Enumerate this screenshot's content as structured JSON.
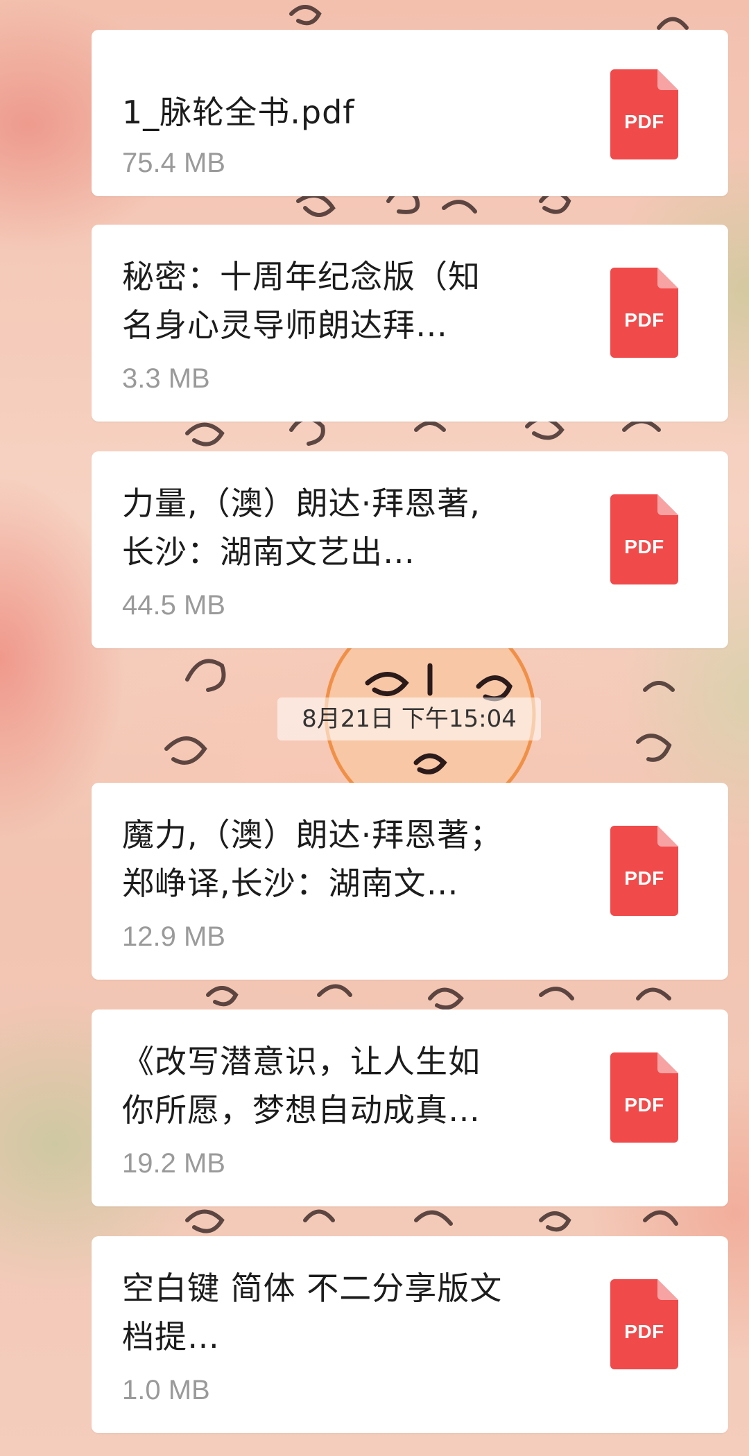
{
  "messages": [
    {
      "title_lines": [
        "1_脉轮全书.pdf"
      ],
      "size": "75.4 MB",
      "icon": "pdf-file-icon",
      "icon_label": "PDF"
    },
    {
      "title_lines": [
        "秘密：十周年纪念版（知",
        "名身心灵导师朗达拜…"
      ],
      "size": "3.3 MB",
      "icon": "pdf-file-icon",
      "icon_label": "PDF"
    },
    {
      "title_lines": [
        "力量,（澳）朗达·拜恩著,",
        "长沙：湖南文艺出…"
      ],
      "size": "44.5 MB",
      "icon": "pdf-file-icon",
      "icon_label": "PDF"
    },
    {
      "title_lines": [
        "魔力,（澳）朗达·拜恩著；",
        "郑峥译,长沙：湖南文…"
      ],
      "size": "12.9 MB",
      "icon": "pdf-file-icon",
      "icon_label": "PDF"
    },
    {
      "title_lines": [
        "《改写潜意识，让人生如",
        "你所愿，梦想自动成真…"
      ],
      "size": "19.2 MB",
      "icon": "pdf-file-icon",
      "icon_label": "PDF"
    },
    {
      "title_lines": [
        "空白键 简体 不二分享版文",
        "档提…"
      ],
      "size": "1.0 MB",
      "icon": "pdf-file-icon",
      "icon_label": "PDF"
    }
  ],
  "timestamp": "8月21日 下午15:04",
  "colors": {
    "pdf_red": "#f04a4a",
    "pdf_fold": "#f7a3a3",
    "card_bg": "#ffffff",
    "size_text": "#9a9a9a"
  }
}
